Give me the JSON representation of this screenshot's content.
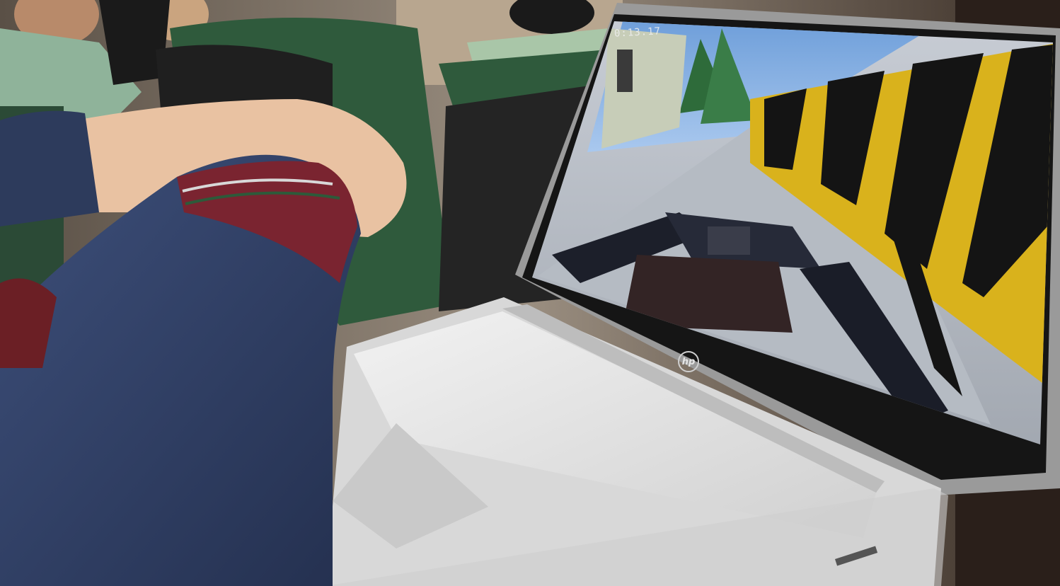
{
  "scene": {
    "description_free": true,
    "game_timer": "0:13.17",
    "laptop_brand_logo": "hp",
    "colors": {
      "wall_yellow": "#d9b21c",
      "wall_black": "#141414",
      "snow": "#d9dde3",
      "sky": "#8cb4e6",
      "laptop_silver": "#dcdcdc",
      "sleeve_denim": "#2f3f66",
      "seat_green": "#2f5a3c"
    }
  }
}
